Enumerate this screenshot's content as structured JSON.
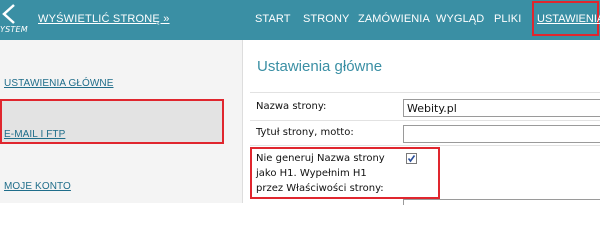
{
  "topbar": {
    "logo_text": "YSTEM",
    "view_link": "WYŚWIETLIĆ STRONĘ »",
    "nav": {
      "start": "START",
      "strony": "STRONY",
      "zamowienia": "ZAMÓWIENIA",
      "wyglad": "WYGLĄD",
      "pliki": "PLIKI",
      "ustawienia": "USTAWIENIA"
    }
  },
  "sidebar": {
    "items": [
      {
        "label": "USTAWIENIA GŁÓWNE"
      },
      {
        "label": "E-MAIL I FTP"
      },
      {
        "label": "MOJE KONTO"
      }
    ]
  },
  "main": {
    "title": "Ustawienia główne",
    "fields": {
      "site_name_label": "Nazwa strony:",
      "site_name_value": "Webity.pl",
      "title_label": "Tytuł strony, motto:",
      "title_value": "",
      "h1_label": "Nie generuj Nazwa strony jako H1. Wypełnim H1 przez Właściwości strony:",
      "h1_checked": true
    }
  },
  "colors": {
    "topbar": "#3a8fa4",
    "highlight": "#e0262e",
    "link": "#1f6d8a"
  }
}
